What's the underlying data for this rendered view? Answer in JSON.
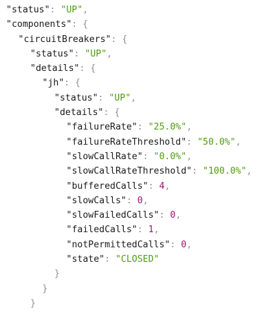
{
  "lines": [
    {
      "indent": 0,
      "key": "\"status\"",
      "sep": ": ",
      "value": "\"UP\"",
      "vtype": "str",
      "trail": ","
    },
    {
      "indent": 0,
      "key": "\"components\"",
      "sep": ": ",
      "value": "{",
      "vtype": "brace",
      "trail": ""
    },
    {
      "indent": 1,
      "key": "\"circuitBreakers\"",
      "sep": ": ",
      "value": "{",
      "vtype": "brace",
      "trail": ""
    },
    {
      "indent": 2,
      "key": "\"status\"",
      "sep": ": ",
      "value": "\"UP\"",
      "vtype": "str",
      "trail": ","
    },
    {
      "indent": 2,
      "key": "\"details\"",
      "sep": ": ",
      "value": "{",
      "vtype": "brace",
      "trail": ""
    },
    {
      "indent": 3,
      "key": "\"jh\"",
      "sep": ": ",
      "value": "{",
      "vtype": "brace",
      "trail": ""
    },
    {
      "indent": 4,
      "key": "\"status\"",
      "sep": ": ",
      "value": "\"UP\"",
      "vtype": "str",
      "trail": ","
    },
    {
      "indent": 4,
      "key": "\"details\"",
      "sep": ": ",
      "value": "{",
      "vtype": "brace",
      "trail": ""
    },
    {
      "indent": 5,
      "key": "\"failureRate\"",
      "sep": ": ",
      "value": "\"25.0%\"",
      "vtype": "str",
      "trail": ","
    },
    {
      "indent": 5,
      "key": "\"failureRateThreshold\"",
      "sep": ": ",
      "value": "\"50.0%\"",
      "vtype": "str",
      "trail": ","
    },
    {
      "indent": 5,
      "key": "\"slowCallRate\"",
      "sep": ": ",
      "value": "\"0.0%\"",
      "vtype": "str",
      "trail": ","
    },
    {
      "indent": 5,
      "key": "\"slowCallRateThreshold\"",
      "sep": ": ",
      "value": "\"100.0%\"",
      "vtype": "str",
      "trail": ","
    },
    {
      "indent": 5,
      "key": "\"bufferedCalls\"",
      "sep": ": ",
      "value": "4",
      "vtype": "num",
      "trail": ","
    },
    {
      "indent": 5,
      "key": "\"slowCalls\"",
      "sep": ": ",
      "value": "0",
      "vtype": "num",
      "trail": ","
    },
    {
      "indent": 5,
      "key": "\"slowFailedCalls\"",
      "sep": ": ",
      "value": "0",
      "vtype": "num",
      "trail": ","
    },
    {
      "indent": 5,
      "key": "\"failedCalls\"",
      "sep": ": ",
      "value": "1",
      "vtype": "num",
      "trail": ","
    },
    {
      "indent": 5,
      "key": "\"notPermittedCalls\"",
      "sep": ": ",
      "value": "0",
      "vtype": "num",
      "trail": ","
    },
    {
      "indent": 5,
      "key": "\"state\"",
      "sep": ": ",
      "value": "\"CLOSED\"",
      "vtype": "str",
      "trail": ""
    },
    {
      "indent": 4,
      "key": "",
      "sep": "",
      "value": "}",
      "vtype": "brace",
      "trail": ""
    },
    {
      "indent": 3,
      "key": "",
      "sep": "",
      "value": "}",
      "vtype": "brace",
      "trail": ""
    },
    {
      "indent": 2,
      "key": "",
      "sep": "",
      "value": "}",
      "vtype": "brace",
      "trail": ""
    }
  ],
  "colors": {
    "key": "#1a1a1a",
    "punctuation": "#8f8f8f",
    "string": "#4f9a12",
    "number": "#a0116e"
  }
}
